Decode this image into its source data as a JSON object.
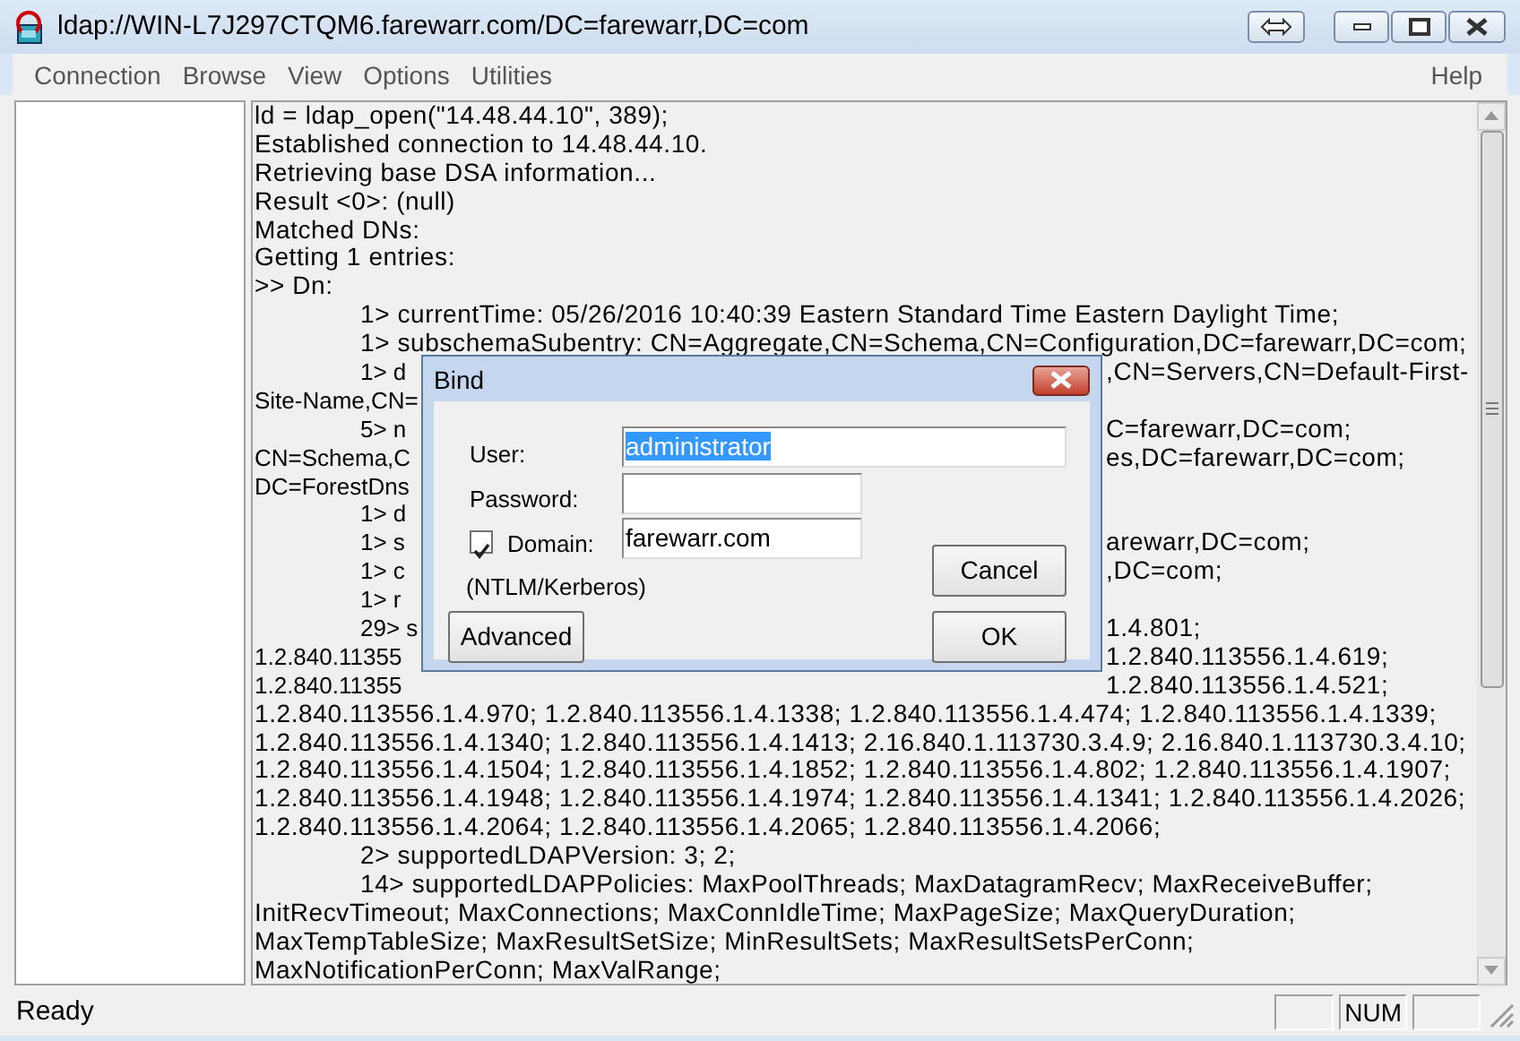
{
  "window": {
    "title": "ldap://WIN-L7J297CTQM6.farewarr.com/DC=farewarr,DC=com"
  },
  "menu": [
    {
      "label": "Connection"
    },
    {
      "label": "Browse"
    },
    {
      "label": "View"
    },
    {
      "label": "Options"
    },
    {
      "label": "Utilities"
    }
  ],
  "help_menu": {
    "label": "Help"
  },
  "log": [
    {
      "text": "ld = ldap_open(\"14.48.44.10\", 389);",
      "indented": false
    },
    {
      "text": "Established connection to 14.48.44.10.",
      "indented": false
    },
    {
      "text": "Retrieving base DSA information...",
      "indented": false
    },
    {
      "text": "Result <0>: (null)",
      "indented": false
    },
    {
      "text": "Matched DNs:",
      "indented": false
    },
    {
      "text": "Getting 1 entries:",
      "indented": false
    },
    {
      "text": ">> Dn:",
      "indented": false
    },
    {
      "text": "1> currentTime: 05/26/2016 10:40:39 Eastern Standard Time Eastern Daylight Time;",
      "indented": true
    },
    {
      "text": "1> subschemaSubentry: CN=Aggregate,CN=Schema,CN=Configuration,DC=farewarr,DC=com;",
      "indented": true
    },
    {
      "text": "1> d",
      "indented": true,
      "kind": "covered",
      "after_dialog": ",CN=Servers,CN=Default-First-"
    },
    {
      "text": "Site-Name,CN=",
      "indented": false,
      "kind": "covered"
    },
    {
      "text": "5> n",
      "indented": true,
      "kind": "covered",
      "after_dialog": "C=farewarr,DC=com;"
    },
    {
      "text": "CN=Schema,C",
      "indented": false,
      "kind": "covered",
      "after_dialog": "es,DC=farewarr,DC=com;"
    },
    {
      "text": "DC=ForestDns",
      "indented": false,
      "kind": "covered"
    },
    {
      "text": "1> d",
      "indented": true,
      "kind": "covered"
    },
    {
      "text": "1> s",
      "indented": true,
      "kind": "covered",
      "after_dialog": "arewarr,DC=com;"
    },
    {
      "text": "1> c",
      "indented": true,
      "kind": "covered",
      "after_dialog": ",DC=com;"
    },
    {
      "text": "1> r",
      "indented": true,
      "kind": "covered"
    },
    {
      "text": "29> s",
      "indented": true,
      "kind": "covered",
      "after_dialog": "1.4.801;"
    },
    {
      "text": "1.2.840.11355",
      "indented": false,
      "kind": "covered",
      "after_dialog": "1.2.840.113556.1.4.619;"
    },
    {
      "text": "1.2.840.11355",
      "indented": false,
      "kind": "covered",
      "after_dialog": "1.2.840.113556.1.4.521;"
    },
    {
      "text": "1.2.840.113556.1.4.970; 1.2.840.113556.1.4.1338; 1.2.840.113556.1.4.474; 1.2.840.113556.1.4.1339;",
      "indented": false
    },
    {
      "text": "1.2.840.113556.1.4.1340; 1.2.840.113556.1.4.1413; 2.16.840.1.113730.3.4.9; 2.16.840.1.113730.3.4.10;",
      "indented": false
    },
    {
      "text": "1.2.840.113556.1.4.1504; 1.2.840.113556.1.4.1852; 1.2.840.113556.1.4.802; 1.2.840.113556.1.4.1907;",
      "indented": false
    },
    {
      "text": "1.2.840.113556.1.4.1948; 1.2.840.113556.1.4.1974; 1.2.840.113556.1.4.1341; 1.2.840.113556.1.4.2026;",
      "indented": false
    },
    {
      "text": "1.2.840.113556.1.4.2064; 1.2.840.113556.1.4.2065; 1.2.840.113556.1.4.2066;",
      "indented": false
    },
    {
      "text": "2> supportedLDAPVersion: 3; 2;",
      "indented": true
    },
    {
      "text": "14> supportedLDAPPolicies: MaxPoolThreads; MaxDatagramRecv; MaxReceiveBuffer;",
      "indented": true
    },
    {
      "text": "InitRecvTimeout; MaxConnections; MaxConnIdleTime; MaxPageSize; MaxQueryDuration;",
      "indented": false
    },
    {
      "text": "MaxTempTableSize; MaxResultSetSize; MinResultSets; MaxResultSetsPerConn;",
      "indented": false
    },
    {
      "text": "MaxNotificationPerConn; MaxValRange;",
      "indented": false
    }
  ],
  "dialog": {
    "title": "Bind",
    "user": {
      "label": "User:",
      "value": "administrator",
      "text_selected": true
    },
    "password": {
      "label": "Password:"
    },
    "domain": {
      "label": "Domain:",
      "checked": true,
      "value": "farewarr.com"
    },
    "note": "(NTLM/Kerberos)",
    "buttons": [
      {
        "label": "Cancel",
        "kind": "cancel"
      },
      {
        "label": "Advanced",
        "kind": "advanced"
      },
      {
        "label": "OK",
        "kind": "ok"
      }
    ]
  },
  "status_bar": {
    "text": "Ready",
    "indicators": [
      {
        "label": "NUM"
      }
    ]
  }
}
